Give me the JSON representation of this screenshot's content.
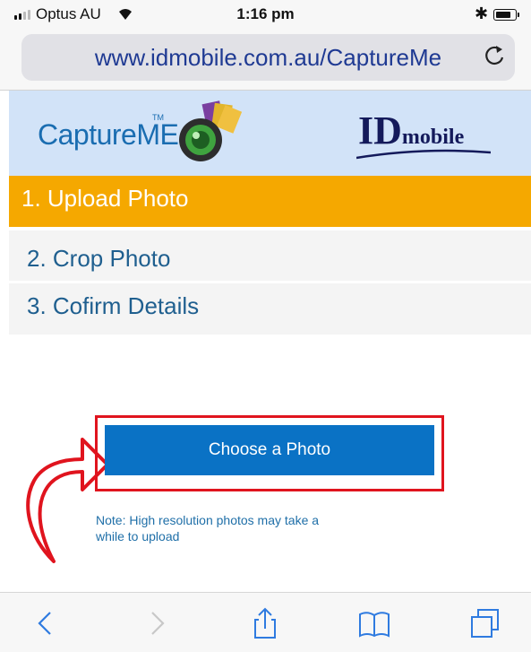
{
  "status_bar": {
    "carrier": "Optus AU",
    "time": "1:16 pm"
  },
  "browser": {
    "url": "www.idmobile.com.au/CaptureMe"
  },
  "header": {
    "app_logo": "CaptureME",
    "app_logo_tm": "TM",
    "partner_logo_big": "ID",
    "partner_logo_small": "mobile"
  },
  "steps": [
    {
      "label": "1. Upload Photo",
      "active": true
    },
    {
      "label": "2. Crop Photo",
      "active": false
    },
    {
      "label": "3. Cofirm Details",
      "active": false
    }
  ],
  "main": {
    "choose_button": "Choose a Photo",
    "note": "Note: High resolution photos may take a while to upload"
  },
  "toolbar": {
    "icons": [
      "back-icon",
      "forward-icon",
      "share-icon",
      "bookmarks-icon",
      "tabs-icon"
    ]
  },
  "colors": {
    "accent_orange": "#f5a800",
    "button_blue": "#0a72c5",
    "highlight_red": "#e0141e",
    "banner_bg": "#d2e3f8",
    "link_blue": "#1f5f8f"
  }
}
